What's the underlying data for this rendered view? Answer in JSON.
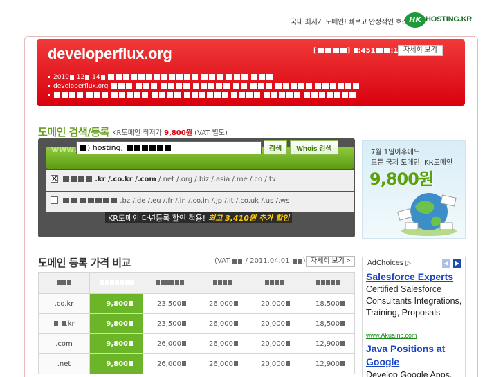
{
  "top_banner": {
    "tagline": "국내 최저가 도메인! 빠르고 안정적인 호스팅!",
    "logo_mark": "HK",
    "logo_word": "HOSTING.KR"
  },
  "header": {
    "domain": "developerflux.org",
    "reg_info_prefix": "[",
    "reg_info_mid": "]",
    "reg_info_count": ":451",
    "reg_info_tail": ":1",
    "detail_button": "자세히 보기",
    "line1_year": "2010",
    "line1_month": "12",
    "line1_day": "14",
    "line2_domain": "developerflux.org"
  },
  "search": {
    "heading": "도메인 검색/등록",
    "sub_prefix": "KR도메인 최저가",
    "sub_price": "9,800원",
    "sub_suffix": "(VAT 별도)",
    "www_label": "www.",
    "input_value": ") hosting,",
    "search_button": "검색",
    "whois_button": "Whois 검색",
    "row1_tlds_bold": ".kr /.co.kr /.com",
    "row1_tlds": "/.net /.org /.biz /.asia /.me /.co /.tv",
    "row2_tlds": ".bz /.de /.eu /.fr /.in /.co.in /.jp /.it /.co.uk /.us /.ws",
    "multi_year": "KR도메인 다년등록 할인 적용!",
    "promo_text": "최고 3,410원 추가 할인"
  },
  "promo_banner": {
    "line1": "7월 1일이후에도",
    "line2": "모든 국제 도메인, KR도메인",
    "price": "9,800원"
  },
  "price_compare": {
    "heading": "도메인 등록 가격 비교",
    "meta_prefix": "(VAT",
    "meta_date": "/ 2011.04.01",
    "meta_suffix": ")",
    "detail_button": "자세히 보기 >",
    "rows": [
      {
        "tld": ".co.kr",
        "ours": "9,800",
        "c1": "23,500",
        "c2": "26,000",
        "c3": "20,000",
        "c4": "18,500"
      },
      {
        "tld": ".kr",
        "ours": "9,800",
        "c1": "23,500",
        "c2": "26,000",
        "c3": "20,000",
        "c4": "18,500"
      },
      {
        "tld": ".com",
        "ours": "9,800",
        "c1": "26,000",
        "c2": "26,000",
        "c3": "20,000",
        "c4": "12,900"
      },
      {
        "tld": ".net",
        "ours": "9,800",
        "c1": "26,000",
        "c2": "26,000",
        "c3": "20,000",
        "c4": "12,900"
      }
    ]
  },
  "ads": {
    "choices_label": "AdChoices",
    "ad1_title": "Salesforce Experts",
    "ad1_body": "Certified Salesforce Consultants Integrations, Training, Proposals",
    "ad1_url": "www.AkuaInc.com",
    "ad2_title_line1": "Java Positions at",
    "ad2_title_line2": "Google",
    "ad2_body": "Develop Google Apps."
  },
  "colors": {
    "header_red": "#e00012",
    "accent_green": "#6cb428",
    "ad_link_blue": "#1a45c4"
  }
}
